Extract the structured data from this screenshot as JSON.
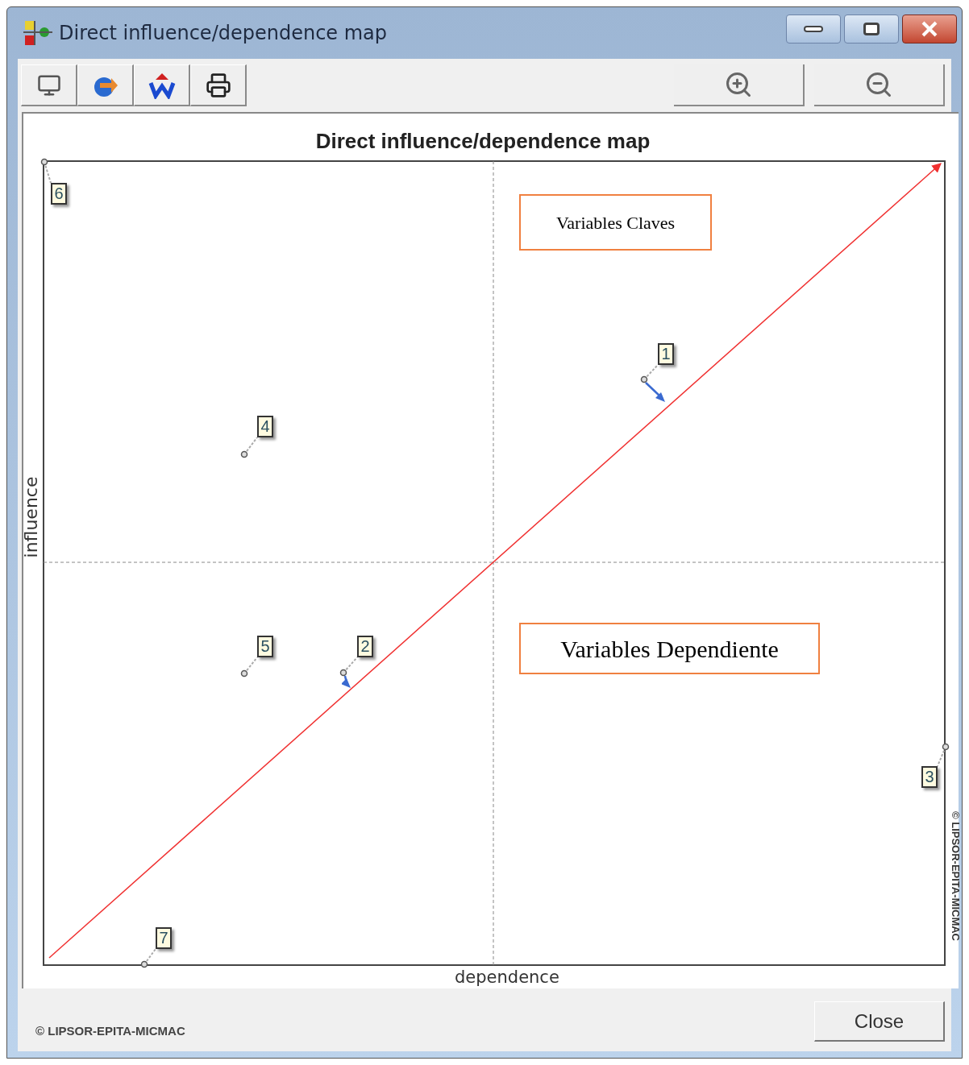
{
  "window": {
    "title": "Direct influence/dependence map"
  },
  "map": {
    "title": "Direct influence/dependence map",
    "ylabel": "influence",
    "xlabel": "dependence",
    "side_credit": "© LIPSOR-EPITA-MICMAC",
    "annotations": [
      {
        "text": "Variables Claves"
      },
      {
        "text": "Variables Dependiente"
      }
    ],
    "variables": [
      {
        "label": "6",
        "kind": "plain"
      },
      {
        "label": "1",
        "kind": "arrow"
      },
      {
        "label": "4",
        "kind": "plain"
      },
      {
        "label": "5",
        "kind": "plain"
      },
      {
        "label": "2",
        "kind": "arrow"
      },
      {
        "label": "3",
        "kind": "plain"
      },
      {
        "label": "7",
        "kind": "plain"
      }
    ]
  },
  "footer": {
    "credit": "© LIPSOR-EPITA-MICMAC",
    "close_button": "Close"
  }
}
